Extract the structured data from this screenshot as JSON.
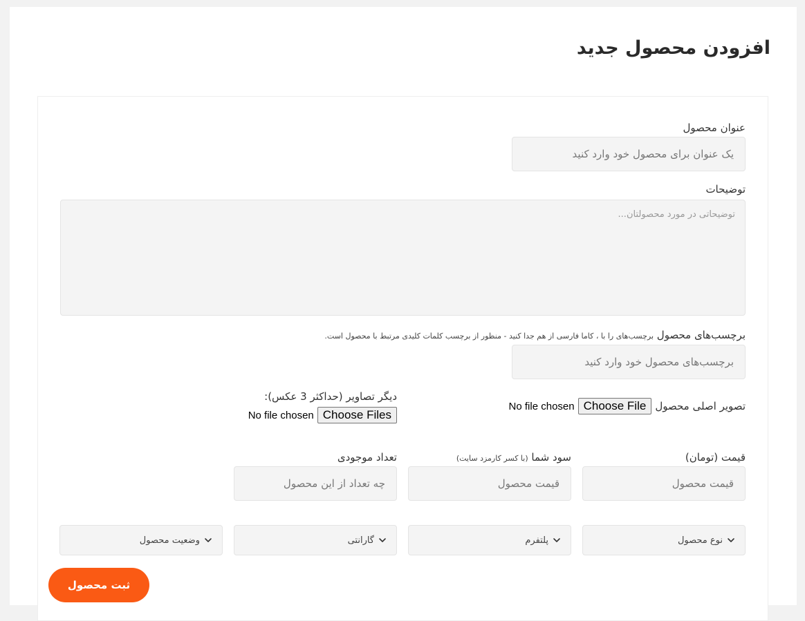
{
  "page": {
    "title": "افزودن محصول جدید"
  },
  "form": {
    "product_title": {
      "label": "عنوان محصول",
      "placeholder": "یک عنوان برای محصول خود وارد کنید"
    },
    "description": {
      "label": "توضیحات",
      "placeholder": "توضیحاتی در مورد محصولتان..."
    },
    "tags": {
      "label": "برچسب‌های محصول",
      "hint": "برچسب‌های را با ، کاما فارسی از هم جدا کنید - منظور از برچسب کلمات کلیدی مرتبط با محصول است.",
      "placeholder": "برچسب‌های محصول خود وارد کنید"
    },
    "main_image": {
      "label": "تصویر اصلی محصول",
      "button": "Choose File",
      "status": "No file chosen"
    },
    "other_images": {
      "label": "دیگر تصاویر (حداکثر 3 عکس):",
      "button": "Choose Files",
      "status": "No file chosen"
    },
    "price": {
      "label": "قیمت (تومان)",
      "placeholder": "قیمت محصول"
    },
    "profit": {
      "label": "سود شما",
      "hint": "(با کسر کارمزد سایت)",
      "placeholder": "قیمت محصول"
    },
    "stock": {
      "label": "تعداد موجودی",
      "placeholder": "چه تعداد از این محصول"
    },
    "selects": {
      "product_type": "نوع محصول",
      "platform": "پلتفرم",
      "warranty": "گارانتی",
      "status": "وضعیت محصول"
    },
    "submit_label": "ثبت محصول"
  },
  "colors": {
    "accent": "#fa5a14",
    "input_bg": "#f4f4f4",
    "page_bg": "#f2f2f2"
  },
  "icons": {
    "select_arrow": "chevron-down-icon"
  }
}
